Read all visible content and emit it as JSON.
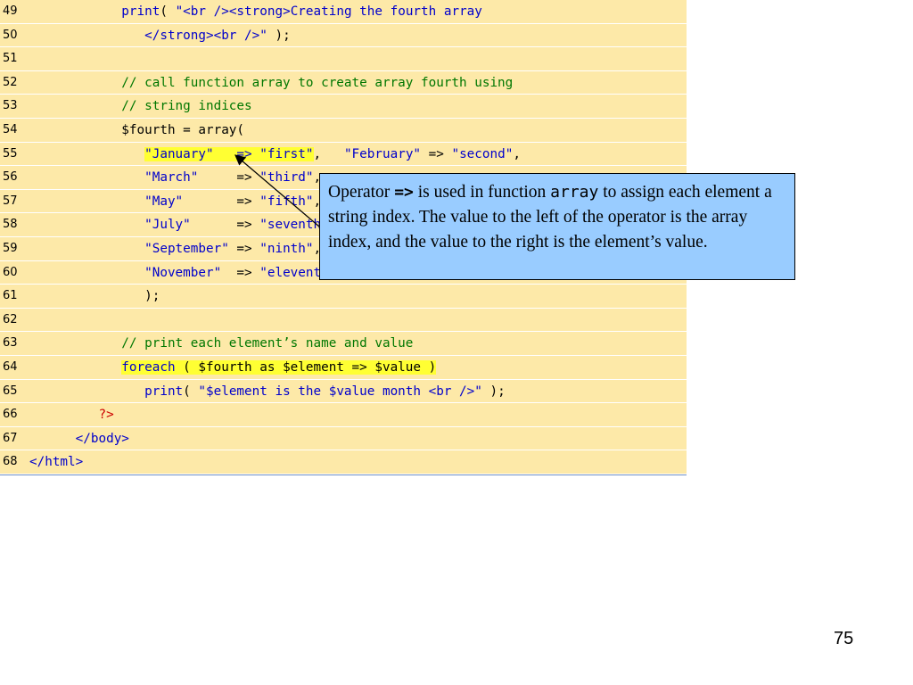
{
  "code": {
    "lines": [
      {
        "num": "49",
        "segments": [
          {
            "t": "            ",
            "c": ""
          },
          {
            "t": "print",
            "c": "kw"
          },
          {
            "t": "( ",
            "c": ""
          },
          {
            "t": "\"<br />",
            "c": "str"
          },
          {
            "t": "<strong>",
            "c": "str"
          },
          {
            "t": "Creating the fourth array",
            "c": "str"
          }
        ]
      },
      {
        "num": "50",
        "segments": [
          {
            "t": "               ",
            "c": ""
          },
          {
            "t": "</strong><br />\"",
            "c": "str"
          },
          {
            "t": " );",
            "c": ""
          }
        ]
      },
      {
        "num": "51",
        "segments": []
      },
      {
        "num": "52",
        "segments": [
          {
            "t": "            ",
            "c": ""
          },
          {
            "t": "// call function array to create array fourth using",
            "c": "cm"
          }
        ]
      },
      {
        "num": "53",
        "segments": [
          {
            "t": "            ",
            "c": ""
          },
          {
            "t": "// string indices",
            "c": "cm"
          }
        ]
      },
      {
        "num": "54",
        "segments": [
          {
            "t": "            ",
            "c": ""
          },
          {
            "t": "$fourth = array(",
            "c": ""
          }
        ]
      },
      {
        "num": "55",
        "segments": [
          {
            "t": "               ",
            "c": ""
          },
          {
            "t": "\"January\"   => ",
            "c": "str hl"
          },
          {
            "t": "\"first\"",
            "c": "str hl"
          },
          {
            "t": ",   ",
            "c": ""
          },
          {
            "t": "\"February\"",
            "c": "str"
          },
          {
            "t": " => ",
            "c": ""
          },
          {
            "t": "\"second\"",
            "c": "str"
          },
          {
            "t": ",",
            "c": ""
          }
        ]
      },
      {
        "num": "56",
        "segments": [
          {
            "t": "               ",
            "c": ""
          },
          {
            "t": "\"March\"",
            "c": "str"
          },
          {
            "t": "     => ",
            "c": ""
          },
          {
            "t": "\"third\"",
            "c": "str"
          },
          {
            "t": ",",
            "c": ""
          }
        ]
      },
      {
        "num": "57",
        "segments": [
          {
            "t": "               ",
            "c": ""
          },
          {
            "t": "\"May\"",
            "c": "str"
          },
          {
            "t": "       => ",
            "c": ""
          },
          {
            "t": "\"fifth\"",
            "c": "str"
          },
          {
            "t": ",",
            "c": ""
          }
        ]
      },
      {
        "num": "58",
        "segments": [
          {
            "t": "               ",
            "c": ""
          },
          {
            "t": "\"July\"",
            "c": "str"
          },
          {
            "t": "      => ",
            "c": ""
          },
          {
            "t": "\"seventh\"",
            "c": "str"
          }
        ]
      },
      {
        "num": "59",
        "segments": [
          {
            "t": "               ",
            "c": ""
          },
          {
            "t": "\"September\"",
            "c": "str"
          },
          {
            "t": " => ",
            "c": ""
          },
          {
            "t": "\"ninth\"",
            "c": "str"
          },
          {
            "t": ",",
            "c": ""
          }
        ]
      },
      {
        "num": "60",
        "segments": [
          {
            "t": "               ",
            "c": ""
          },
          {
            "t": "\"November\"",
            "c": "str"
          },
          {
            "t": "  => ",
            "c": ""
          },
          {
            "t": "\"eleventh",
            "c": "str"
          }
        ]
      },
      {
        "num": "61",
        "segments": [
          {
            "t": "               ",
            "c": ""
          },
          {
            "t": ");",
            "c": ""
          }
        ]
      },
      {
        "num": "62",
        "segments": []
      },
      {
        "num": "63",
        "segments": [
          {
            "t": "            ",
            "c": ""
          },
          {
            "t": "// print each element’s name and value",
            "c": "cm"
          }
        ]
      },
      {
        "num": "64",
        "segments": [
          {
            "t": "            ",
            "c": ""
          },
          {
            "t": "foreach",
            "c": "kw hl"
          },
          {
            "t": " ( $fourth as $element => $value )",
            "c": "hl"
          }
        ]
      },
      {
        "num": "65",
        "segments": [
          {
            "t": "               ",
            "c": ""
          },
          {
            "t": "print",
            "c": "kw"
          },
          {
            "t": "( ",
            "c": ""
          },
          {
            "t": "\"$element is the $value month <br />\"",
            "c": "str"
          },
          {
            "t": " );",
            "c": ""
          }
        ]
      },
      {
        "num": "66",
        "segments": [
          {
            "t": "         ",
            "c": ""
          },
          {
            "t": "?>",
            "c": "php"
          }
        ]
      },
      {
        "num": "67",
        "segments": [
          {
            "t": "      ",
            "c": ""
          },
          {
            "t": "</body>",
            "c": "tag"
          }
        ]
      },
      {
        "num": "68",
        "segments": [
          {
            "t": "</html>",
            "c": "tag"
          }
        ]
      }
    ]
  },
  "callout": {
    "parts": [
      {
        "t": "Operator ",
        "c": ""
      },
      {
        "t": "=>",
        "c": "mono bold"
      },
      {
        "t": " is used in function ",
        "c": ""
      },
      {
        "t": "array",
        "c": "mono"
      },
      {
        "t": " to assign each element a string index. The value to the left of the operator is the array index, and the value to the right is the element’s value.",
        "c": ""
      }
    ]
  },
  "page_number": "75",
  "colors": {
    "code_background": "#fde9a8",
    "callout_background": "#99ccff",
    "highlight": "#ffff33",
    "keyword": "#0000cc",
    "comment": "#007700",
    "php_tag": "#cc0000"
  }
}
